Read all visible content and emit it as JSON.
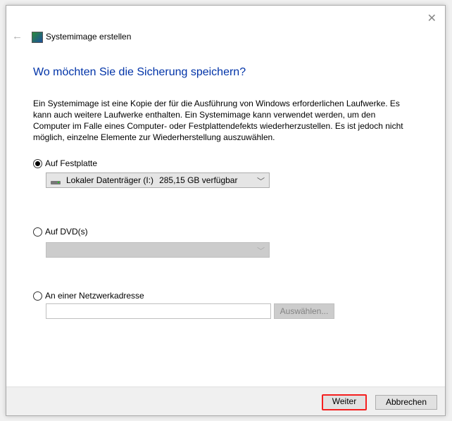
{
  "window": {
    "title": "Systemimage erstellen",
    "close_label": "✕",
    "back_label": "←"
  },
  "heading": "Wo möchten Sie die Sicherung speichern?",
  "description": "Ein Systemimage ist eine Kopie der für die Ausführung von Windows erforderlichen Laufwerke. Es kann auch weitere Laufwerke enthalten. Ein Systemimage kann verwendet werden, um den Computer im Falle eines Computer- oder Festplattendefekts wiederherzustellen. Es ist jedoch nicht möglich, einzelne Elemente zur Wiederherstellung auszuwählen.",
  "options": {
    "hdd": {
      "label": "Auf Festplatte",
      "selected": true,
      "drive": "Lokaler Datenträger (I:)",
      "free": "285,15 GB verfügbar"
    },
    "dvd": {
      "label": "Auf DVD(s)",
      "selected": false,
      "value": ""
    },
    "network": {
      "label": "An einer Netzwerkadresse",
      "selected": false,
      "value": "",
      "browse_label": "Auswählen..."
    }
  },
  "footer": {
    "next_label": "Weiter",
    "cancel_label": "Abbrechen"
  },
  "colors": {
    "heading": "#0033a8",
    "highlight": "#f51f1f"
  }
}
